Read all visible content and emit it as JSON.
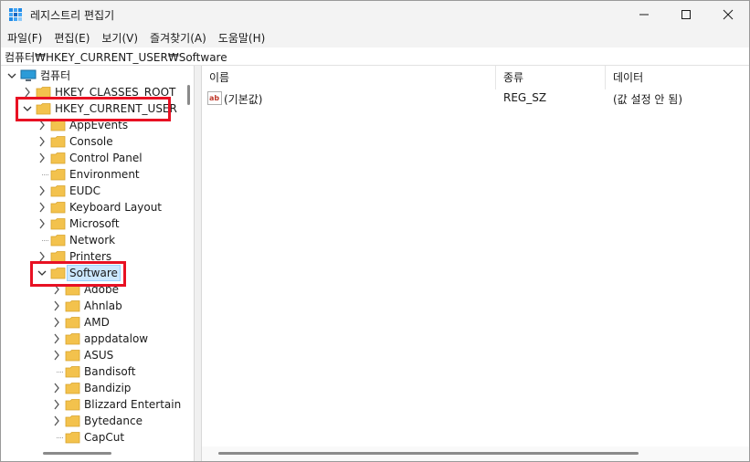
{
  "window": {
    "title": "레지스트리 편집기",
    "minimize_symbol": "—",
    "maximize_symbol": "☐",
    "close_symbol": "✕"
  },
  "menu": {
    "items": [
      {
        "label": "파일(F)"
      },
      {
        "label": "편집(E)"
      },
      {
        "label": "보기(V)"
      },
      {
        "label": "즐겨찾기(A)"
      },
      {
        "label": "도움말(H)"
      }
    ]
  },
  "address": {
    "path": "컴퓨터₩HKEY_CURRENT_USER₩Software"
  },
  "tree": {
    "root": "컴퓨터",
    "hkcr": "HKEY_CLASSES_ROOT",
    "hkcu": "HKEY_CURRENT_USER",
    "hkcu_children": [
      {
        "label": "AppEvents",
        "expandable": true
      },
      {
        "label": "Console",
        "expandable": true
      },
      {
        "label": "Control Panel",
        "expandable": true
      },
      {
        "label": "Environment",
        "expandable": false
      },
      {
        "label": "EUDC",
        "expandable": true
      },
      {
        "label": "Keyboard Layout",
        "expandable": true
      },
      {
        "label": "Microsoft",
        "expandable": true
      },
      {
        "label": "Network",
        "expandable": false
      },
      {
        "label": "Printers",
        "expandable": true
      }
    ],
    "software": "Software",
    "software_children": [
      {
        "label": "Adobe",
        "expandable": true
      },
      {
        "label": "Ahnlab",
        "expandable": true
      },
      {
        "label": "AMD",
        "expandable": true
      },
      {
        "label": "appdatalow",
        "expandable": true
      },
      {
        "label": "ASUS",
        "expandable": true
      },
      {
        "label": "Bandisoft",
        "expandable": false
      },
      {
        "label": "Bandizip",
        "expandable": true
      },
      {
        "label": "Blizzard Entertainment",
        "expandable": true
      },
      {
        "label": "Bytedance",
        "expandable": true
      },
      {
        "label": "CapCut",
        "expandable": false
      }
    ]
  },
  "list": {
    "columns": {
      "name": "이름",
      "type": "종류",
      "data": "데이터"
    },
    "rows": [
      {
        "icon": "ab-string-icon",
        "name": "(기본값)",
        "type": "REG_SZ",
        "data": "(값 설정 안 됨)"
      }
    ]
  },
  "colors": {
    "highlight": "#e81123",
    "selection": "#cce8ff",
    "folder": "#f3c24d"
  }
}
